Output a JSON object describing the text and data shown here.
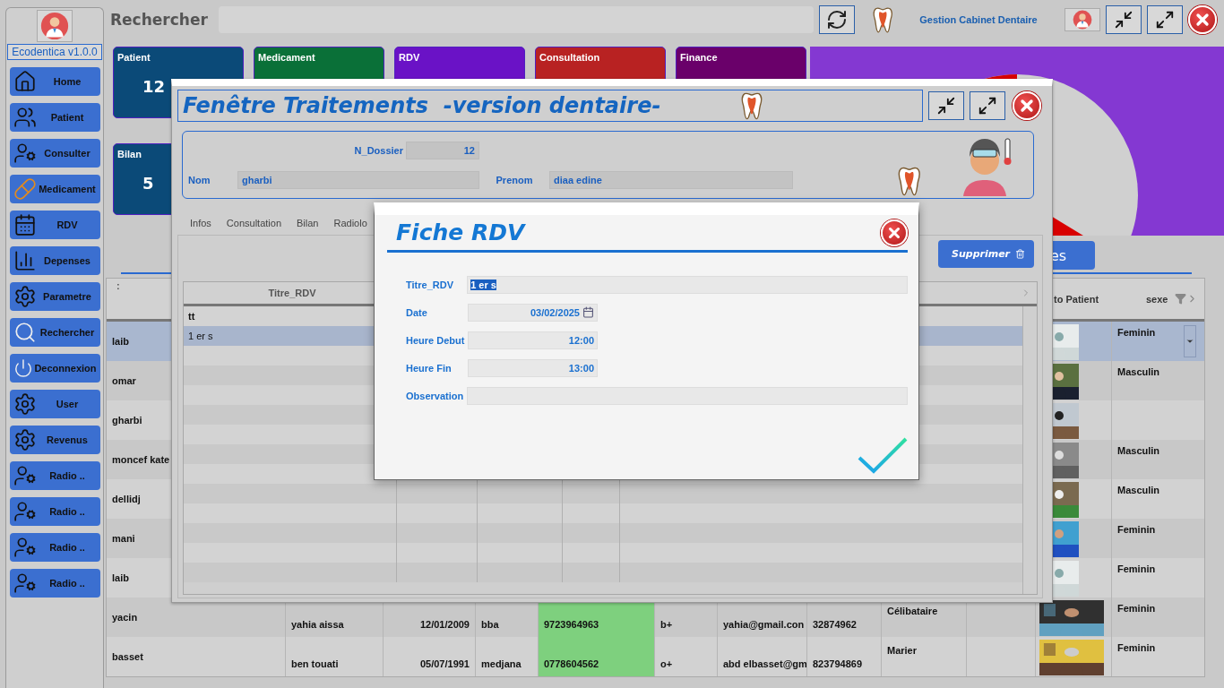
{
  "sidebar": {
    "app_name": "Ecodentica v1.0.0",
    "items": [
      {
        "label": "Home",
        "kind": "home"
      },
      {
        "label": "Patient",
        "kind": "walk"
      },
      {
        "label": "Consulter",
        "kind": "doctor"
      },
      {
        "label": "Medicament",
        "kind": "pill"
      },
      {
        "label": "RDV",
        "kind": "calendar"
      },
      {
        "label": "Depenses",
        "kind": "chart"
      },
      {
        "label": "Parametre",
        "kind": "gears"
      },
      {
        "label": "Rechercher",
        "kind": "search"
      },
      {
        "label": "Deconnexion",
        "kind": "power"
      },
      {
        "label": "User",
        "kind": "gears"
      },
      {
        "label": "Revenus",
        "kind": "gears"
      },
      {
        "label": "Radio ..",
        "kind": "doctor"
      },
      {
        "label": "Radio ..",
        "kind": "doctor"
      },
      {
        "label": "Radio ..",
        "kind": "doctor"
      },
      {
        "label": "Radio ..",
        "kind": "doctor"
      }
    ]
  },
  "header": {
    "search_label": "Rechercher",
    "app_title": "Gestion Cabinet Dentaire"
  },
  "tiles": [
    {
      "label": "Patient",
      "value": "12",
      "color": "#0b4a78"
    },
    {
      "label": "Medicament",
      "color": "#0a7038"
    },
    {
      "label": "RDV",
      "color": "#6a12c6"
    },
    {
      "label": "Consultation",
      "color": "#b82222"
    },
    {
      "label": "Finance",
      "color": "#6a006a"
    },
    {
      "label": "Bilan",
      "value": "5",
      "color": "#0b4a78"
    }
  ],
  "side_button": {
    "label": "es"
  },
  "patients_table": {
    "handle": ":",
    "columns": [
      {
        "label": "to Patient"
      },
      {
        "label": "sexe"
      }
    ],
    "rows": [
      {
        "name": "laib",
        "sexe": "Feminin",
        "selected": true
      },
      {
        "name": "omar",
        "sexe": "Masculin",
        "selected": false
      },
      {
        "name": "gharbi",
        "selected": false
      },
      {
        "name": "moncef kate",
        "sexe": "Masculin",
        "selected": false
      },
      {
        "name": "dellidj",
        "sexe": "Masculin",
        "selected": false
      },
      {
        "name": "mani",
        "sexe": "Feminin",
        "selected": false
      },
      {
        "name": "laib",
        "sexe": "Feminin",
        "selected": false
      },
      {
        "name": "yacin",
        "cells": [
          "yahia aissa",
          "12/01/2009",
          "bba",
          "9723964963",
          "b+",
          "yahia@gmail.con",
          "32874962",
          "Célibataire"
        ],
        "sexe": "Feminin",
        "selected": false
      },
      {
        "name": "basset",
        "cells": [
          "ben touati",
          "05/07/1991",
          "medjana",
          "0778604562",
          "o+",
          "abd elbasset@gm",
          "823794869",
          "Marier"
        ],
        "sexe": "Feminin",
        "selected": false
      }
    ]
  },
  "treatment_window": {
    "title": "Fenêtre Traitements  -version dentaire-",
    "fields": {
      "dossier_label": "N_Dossier",
      "dossier": "12",
      "nom_label": "Nom",
      "nom": "gharbi",
      "prenom_label": "Prenom",
      "prenom": "diaa edine"
    },
    "tabs": [
      {
        "label": "Infos"
      },
      {
        "label": "Consultation"
      },
      {
        "label": "Bilan"
      },
      {
        "label": "Radiolo"
      }
    ],
    "delete_button": "Supprimer",
    "rdv_table": {
      "columns": [
        "Titre_RDV"
      ],
      "rows": [
        {
          "title": "tt",
          "selected": false
        },
        {
          "title": "1 er s",
          "selected": true
        }
      ]
    }
  },
  "dialog": {
    "title": "Fiche RDV",
    "fields": [
      {
        "label": "Titre_RDV",
        "value": "1 er s",
        "kind": "text",
        "text_selected": true
      },
      {
        "label": "Date",
        "value": "03/02/2025",
        "kind": "date",
        "text_selected": false
      },
      {
        "label": "Heure Debut",
        "value": "12:00",
        "kind": "time",
        "text_selected": false
      },
      {
        "label": "Heure Fin",
        "value": "13:00",
        "kind": "time",
        "text_selected": false
      },
      {
        "label": "Observation",
        "kind": "text",
        "text_selected": false
      }
    ]
  }
}
